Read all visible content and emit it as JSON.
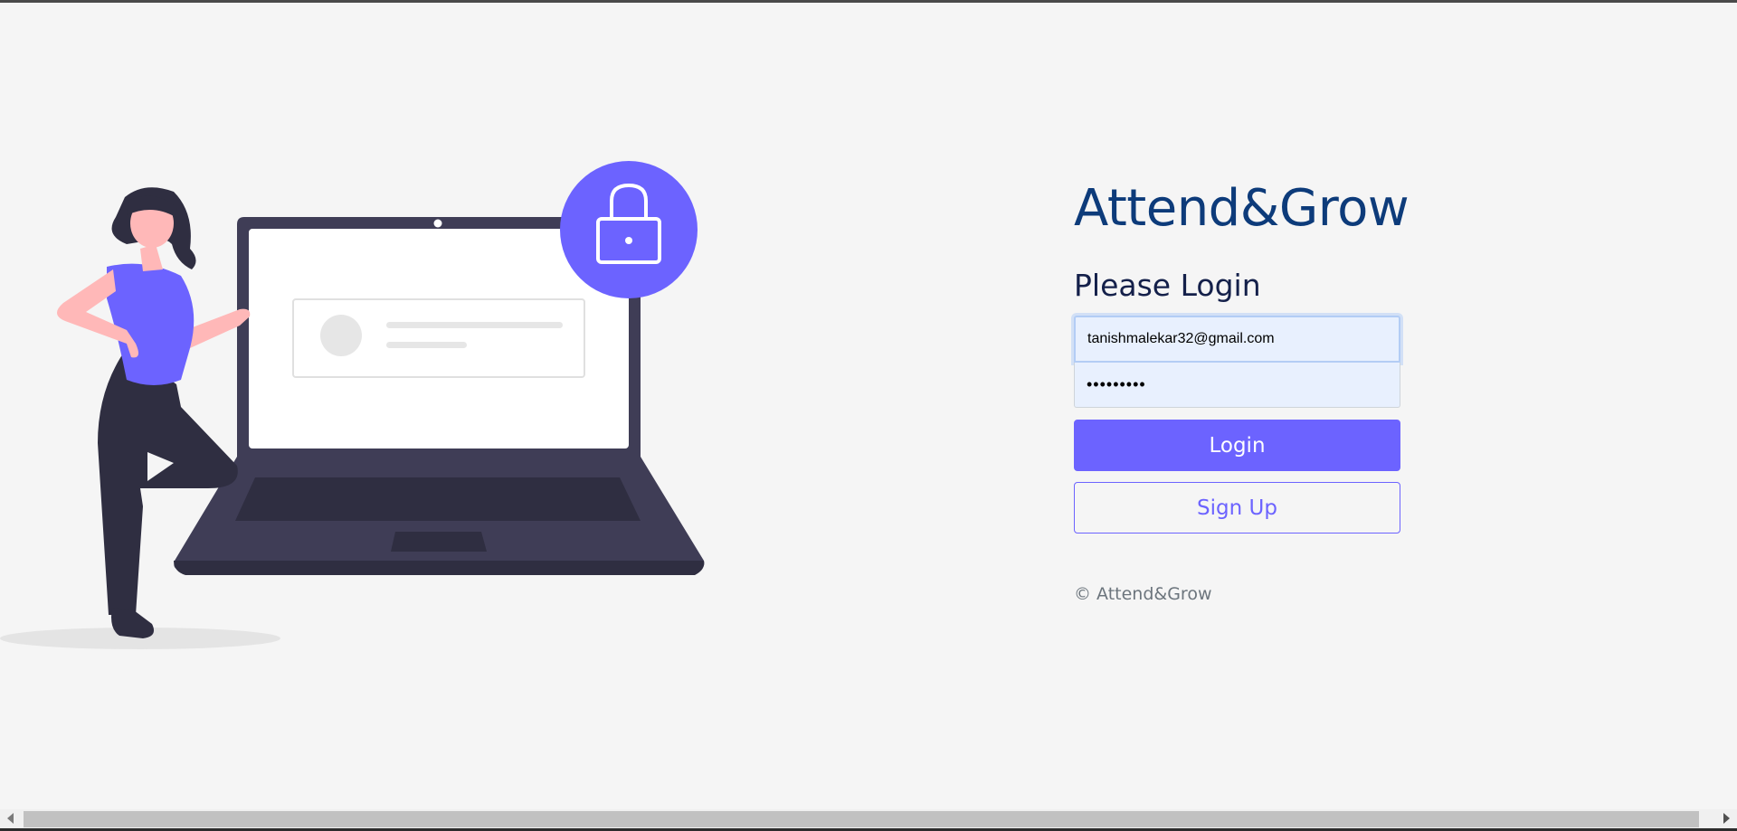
{
  "app": {
    "brand": "Attend&Grow"
  },
  "login": {
    "title": "Please Login",
    "email_value": "tanishmalekar32@gmail.com",
    "password_value": "•••••••••",
    "login_label": "Login",
    "signup_label": "Sign Up"
  },
  "footer": {
    "copyright": "© Attend&Grow"
  },
  "colors": {
    "accent": "#6c63ff",
    "brand": "#0d3b7a",
    "background": "#f5f5f5",
    "input_fill": "#e8f0fe"
  },
  "illustration": {
    "icon": "lock-icon"
  }
}
